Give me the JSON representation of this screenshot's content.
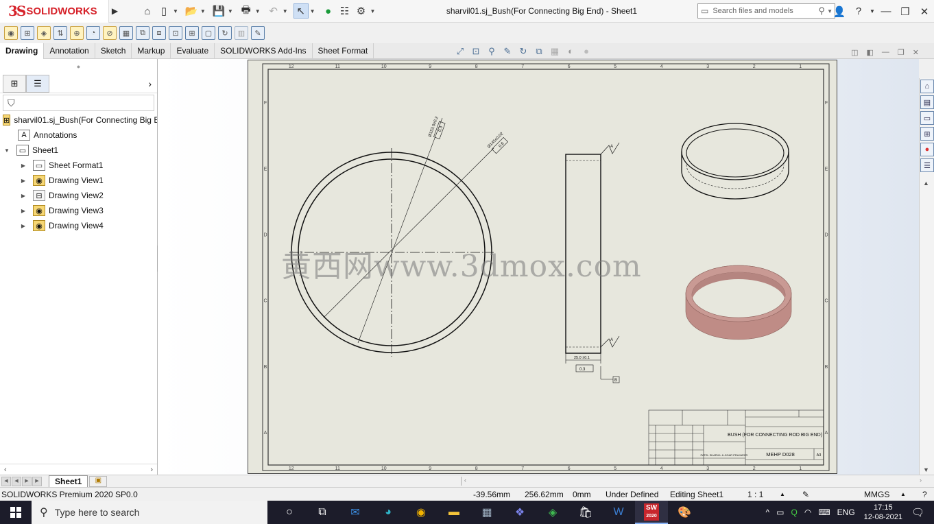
{
  "app": {
    "logo_mark": "3S",
    "logo_text": "SOLIDWORKS",
    "doc_title": "sharvil01.sj_Bush(For Connecting Big End) - Sheet1",
    "search_placeholder": "Search files and models"
  },
  "tabs": [
    {
      "label": "Drawing"
    },
    {
      "label": "Annotation"
    },
    {
      "label": "Sketch"
    },
    {
      "label": "Markup"
    },
    {
      "label": "Evaluate"
    },
    {
      "label": "SOLIDWORKS Add-Ins"
    },
    {
      "label": "Sheet Format"
    }
  ],
  "tree": {
    "root": "sharvil01.sj_Bush(For Connecting Big E",
    "items": [
      {
        "label": "Annotations"
      },
      {
        "label": "Sheet1"
      },
      {
        "label": "Sheet Format1"
      },
      {
        "label": "Drawing View1"
      },
      {
        "label": "Drawing View2"
      },
      {
        "label": "Drawing View3"
      },
      {
        "label": "Drawing View4"
      }
    ]
  },
  "sheet": {
    "zone_numbers": [
      "12",
      "11",
      "10",
      "9",
      "8",
      "7",
      "6",
      "5",
      "4",
      "3",
      "2",
      "1"
    ],
    "zone_letters": [
      "F",
      "E",
      "D",
      "C",
      "B",
      "A"
    ],
    "dims": {
      "outer_dia": "Ø153.0±0.2",
      "outer_tol": "0.3",
      "inner_dia": "Ø145±0.02",
      "inner_tol": "0.6",
      "width": "25.0 ±0.1",
      "datum_tol": "0.3",
      "datum_a": "A",
      "datum_b": "B"
    },
    "title_block": {
      "part_name": "BUSH (FOR CONNECTING ROD BIG END)",
      "dwg_no": "MEHP D028",
      "size": "A3",
      "drawn_by": "PATEL SHARVIL & JIGAR PRAJAPATI"
    }
  },
  "watermark": "黄西网www.3dmox.com",
  "sheet_tab": "Sheet1",
  "status": {
    "product": "SOLIDWORKS Premium 2020 SP0.0",
    "x": "-39.56mm",
    "y": "256.62mm",
    "z": "0mm",
    "state": "Under Defined",
    "editing": "Editing Sheet1",
    "scale": "1 : 1",
    "units": "MMGS"
  },
  "taskbar": {
    "search_placeholder": "Type here to search",
    "lang": "ENG",
    "time": "17:15",
    "date": "12-08-2021",
    "sw_badge": "2020"
  },
  "colors": {
    "brand_red": "#d6222a",
    "sheet_bg": "#e7e7dd",
    "bush_shaded": "#c99a94"
  }
}
